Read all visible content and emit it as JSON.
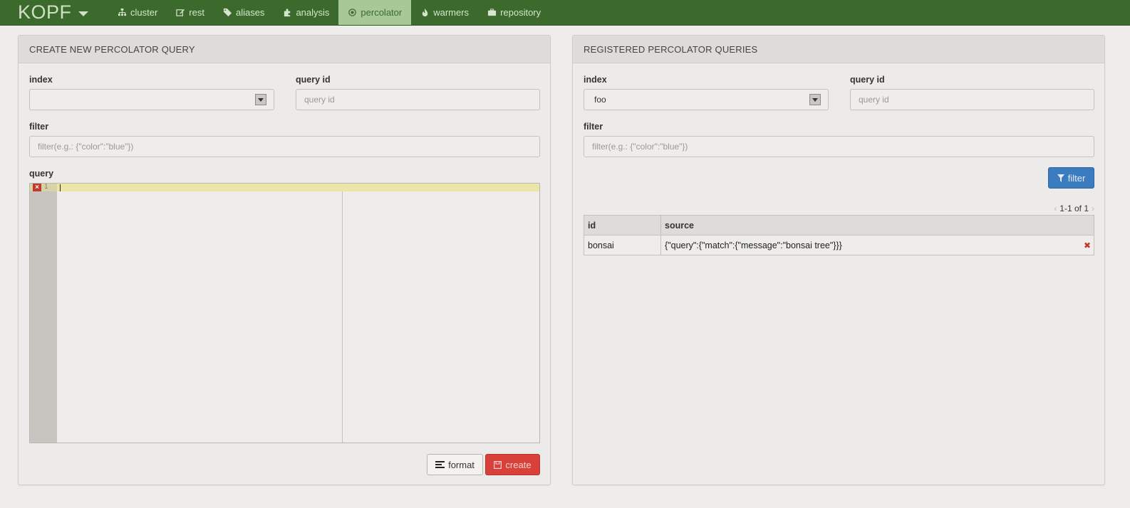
{
  "navbar": {
    "brand": "KOPF",
    "items": [
      {
        "label": "cluster",
        "icon": "sitemap-icon"
      },
      {
        "label": "rest",
        "icon": "edit-icon"
      },
      {
        "label": "aliases",
        "icon": "tags-icon"
      },
      {
        "label": "analysis",
        "icon": "puzzle-icon"
      },
      {
        "label": "percolator",
        "icon": "dot-circle-icon",
        "active": true
      },
      {
        "label": "warmers",
        "icon": "fire-icon"
      },
      {
        "label": "repository",
        "icon": "briefcase-icon"
      }
    ],
    "colors": {
      "background": "#3b6a2c",
      "active": "#a9c898"
    }
  },
  "create_panel": {
    "title": "CREATE NEW PERCOLATOR QUERY",
    "index_label": "index",
    "index_value": "",
    "query_id_label": "query id",
    "query_id_placeholder": "query id",
    "filter_label": "filter",
    "filter_placeholder": "filter(e.g.: {\"color\":\"blue\"})",
    "query_label": "query",
    "editor": {
      "line_number": "1",
      "error_icon": "error-x-icon"
    },
    "format_button": "format",
    "create_button": "create"
  },
  "registered_panel": {
    "title": "REGISTERED PERCOLATOR QUERIES",
    "index_label": "index",
    "index_value": "foo",
    "query_id_label": "query id",
    "query_id_placeholder": "query id",
    "filter_label": "filter",
    "filter_placeholder": "filter(e.g.: {\"color\":\"blue\"})",
    "filter_button": "filter",
    "pager": {
      "text": "1-1 of 1",
      "prev": "‹",
      "next": "›"
    },
    "table": {
      "headers": [
        "id",
        "source"
      ],
      "rows": [
        {
          "id": "bonsai",
          "source": "{\"query\":{\"match\":{\"message\":\"bonsai tree\"}}}"
        }
      ]
    },
    "colors": {
      "filter_button": "#3b7bbf",
      "create_button": "#d9403a"
    }
  }
}
